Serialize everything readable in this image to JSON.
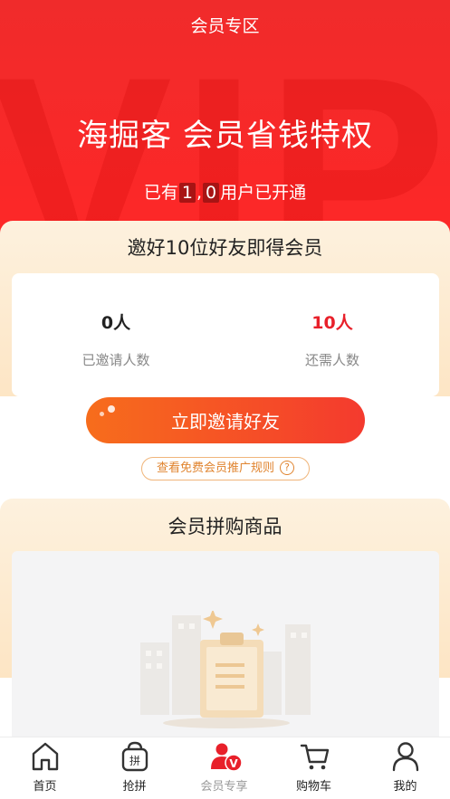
{
  "header": {
    "title": "会员专区",
    "watermark": "VIP"
  },
  "hero": {
    "headline": "海掘客 会员省钱特权",
    "count_prefix": "已有",
    "count_digit1": "1",
    "count_separator": ",",
    "count_digit2": "0",
    "count_suffix": "用户已开通"
  },
  "invite": {
    "title": "邀好10位好友即得会员",
    "invited_value": "0人",
    "invited_label": "已邀请人数",
    "needed_value": "10人",
    "needed_label": "还需人数",
    "invite_button": "立即邀请好友",
    "rules_link": "查看免费会员推广规则",
    "rules_icon": "?"
  },
  "goods": {
    "title": "会员拼购商品",
    "empty_icon": "empty-clipboard-illustration"
  },
  "tabbar": {
    "tabs": [
      {
        "label": "首页",
        "icon": "home-icon"
      },
      {
        "label": "抢拼",
        "icon": "group-buy-bag-icon"
      },
      {
        "label": "会员专享",
        "icon": "vip-user-icon"
      },
      {
        "label": "购物车",
        "icon": "cart-icon"
      },
      {
        "label": "我的",
        "icon": "profile-icon"
      }
    ],
    "active_index": 2
  },
  "colors": {
    "primary_red": "#ff2727",
    "accent_red": "#e8202a",
    "button_gradient_start": "#f76d1c",
    "button_gradient_end": "#f43a2e",
    "card_background": "#fde5c4",
    "rules_orange": "#e0842f"
  }
}
